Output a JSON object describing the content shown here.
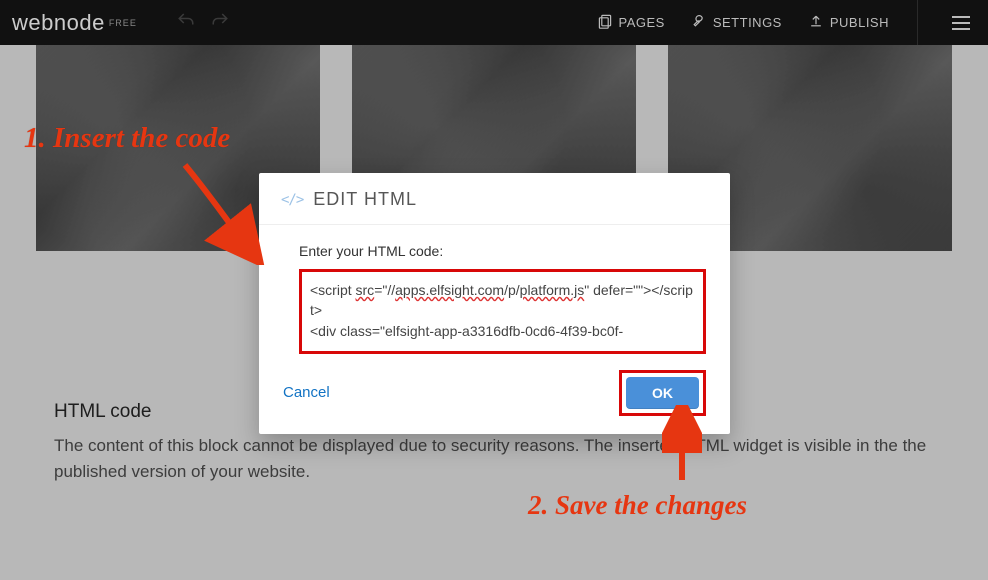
{
  "topbar": {
    "logo": "webnode",
    "badge": "FREE",
    "pages": "PAGES",
    "settings": "SETTINGS",
    "publish": "PUBLISH"
  },
  "htmlBlock": {
    "title": "HTML code",
    "desc": "The content of this block cannot be displayed due to security reasons. The inserted HTML widget is visible in the the published version of your website."
  },
  "modal": {
    "icon": "</>",
    "title": "EDIT HTML",
    "label": "Enter your HTML code:",
    "code_line1_a": "<script ",
    "code_line1_src": "src",
    "code_line1_b": "=\"//",
    "code_line1_host": "apps.elfsight.com",
    "code_line1_c": "/p/",
    "code_line1_file": "platform.js",
    "code_line1_d": "\" defer=\"\"></script>",
    "code_line2": "<div class=\"elfsight-app-a3316dfb-0cd6-4f39-bc0f-",
    "cancel": "Cancel",
    "ok": "OK"
  },
  "annotations": {
    "step1": "1. Insert the code",
    "step2": "2. Save the changes"
  }
}
